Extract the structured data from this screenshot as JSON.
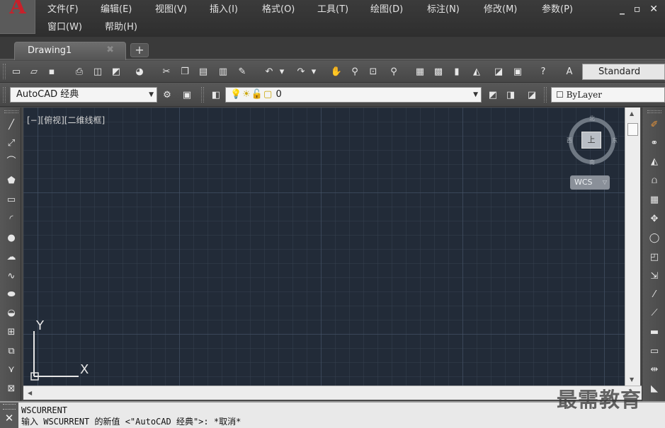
{
  "menu": {
    "row1": [
      "文件(F)",
      "编辑(E)",
      "视图(V)",
      "插入(I)",
      "格式(O)",
      "工具(T)",
      "绘图(D)",
      "标注(N)",
      "修改(M)",
      "参数(P)"
    ],
    "row2": [
      "窗口(W)",
      "帮助(H)"
    ]
  },
  "window_controls": "_ ▫ ✕",
  "tabs": {
    "active": "Drawing1",
    "close": "✖",
    "new_tab": "+"
  },
  "toolbar1": {
    "style_value": "Standard"
  },
  "toolbar2": {
    "workspace": "AutoCAD 经典",
    "layer_icons": "💡☀🔓▢",
    "layer_value": "0",
    "bylayer_value": "ByLayer",
    "bylayer_prefix": "☐"
  },
  "canvas": {
    "viewport_label": "[−][俯视][二维线框]",
    "viewcube": {
      "face": "上",
      "north": "北",
      "south": "南",
      "east": "东",
      "west": "西"
    },
    "wcs": "WCS",
    "wcs_arrow": "▽",
    "ucs": {
      "x": "X",
      "y": "Y"
    }
  },
  "command_line": {
    "close": "✕",
    "line1": "WSCURRENT",
    "line2": "输入 WSCURRENT 的新值 <\"AutoCAD 经典\">: *取消*"
  },
  "watermark": "最需教育",
  "colors": {
    "canvas_bg": "#222b38",
    "chrome": "#4a4a4a",
    "logo_red": "#c8202a"
  }
}
